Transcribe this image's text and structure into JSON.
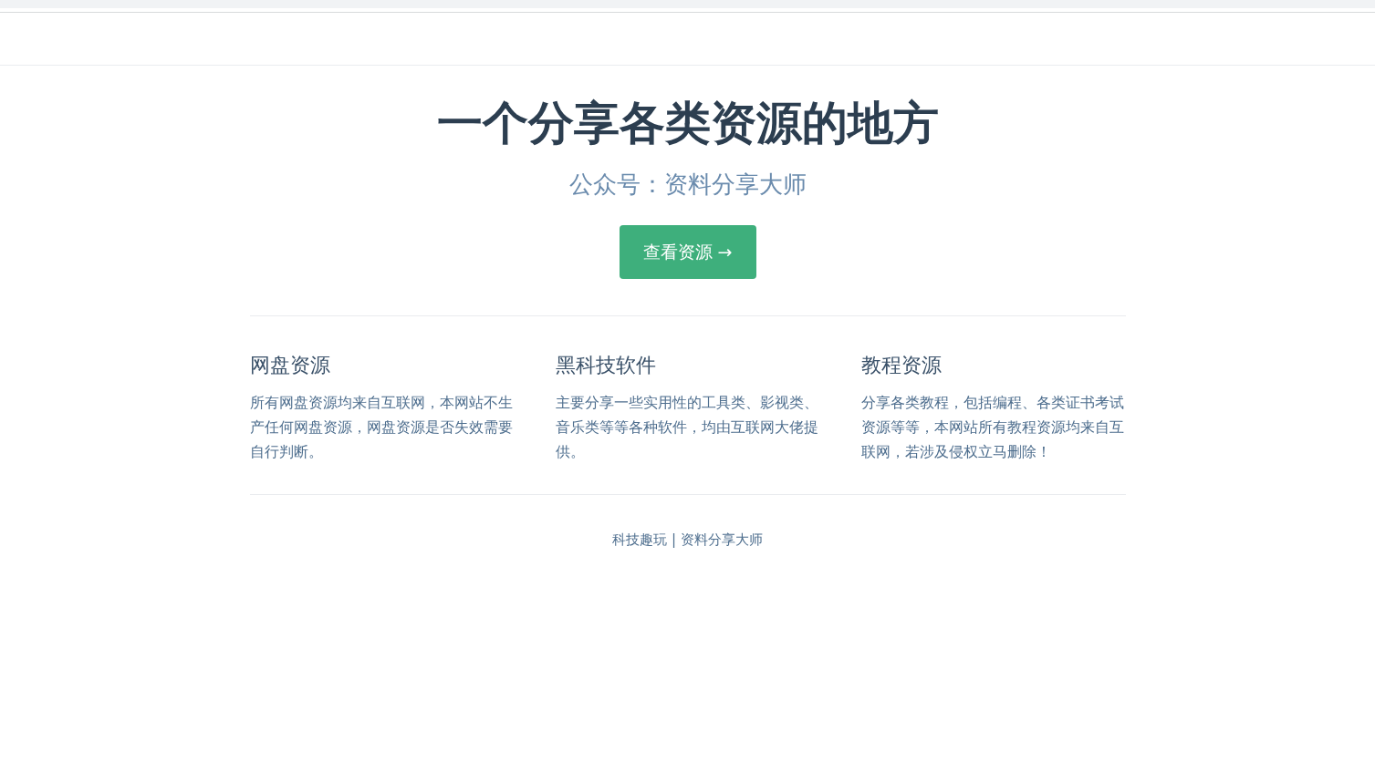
{
  "hero": {
    "title": "一个分享各类资源的地方",
    "subtitle": "公众号：资料分享大师",
    "action": "查看资源 →"
  },
  "features": [
    {
      "title": "网盘资源",
      "details": "所有网盘资源均来自互联网，本网站不生产任何网盘资源，网盘资源是否失效需要自行判断。"
    },
    {
      "title": "黑科技软件",
      "details": "主要分享一些实用性的工具类、影视类、音乐类等等各种软件，均由互联网大佬提供。"
    },
    {
      "title": "教程资源",
      "details": "分享各类教程，包括编程、各类证书考试资源等等，本网站所有教程资源均来自互联网，若涉及侵权立马删除！"
    }
  ],
  "footer": "科技趣玩 | 资料分享大师"
}
